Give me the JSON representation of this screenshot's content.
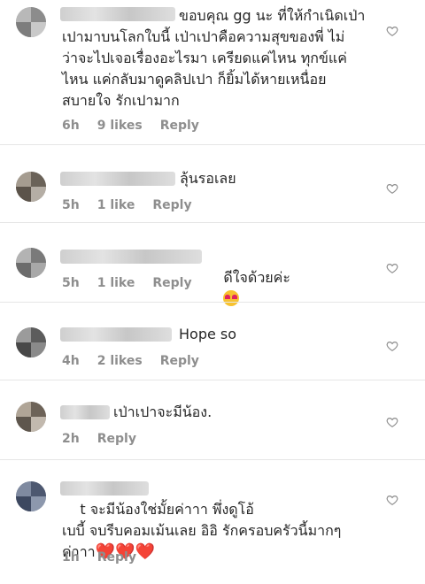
{
  "comments": [
    {
      "text": "ขอบคุณ gg นะ ที่ให้กำเนิดเป่า\nเปามาบนโลกใบนี้ เป่าเปาคือความสุขของพี่ ไม่\nว่าจะไปเจอเรื่องอะไรมา เครียดแค่ไหน ทุกข์แค่\nไหน แค่กลับมาดูคลิปเปา ก็ยิ้มได้หายเหนื่อย\nสบายใจ รักเปามาก",
      "time": "6h",
      "likes": "9 likes",
      "reply": "Reply"
    },
    {
      "text": "ลุ้นรอเลย",
      "time": "5h",
      "likes": "1 like",
      "reply": "Reply"
    },
    {
      "text": "ดีใจด้วยค่ะ",
      "emoji": "heart-eyes",
      "time": "5h",
      "likes": "1 like",
      "reply": "Reply"
    },
    {
      "text": "Hope so",
      "time": "4h",
      "likes": "2 likes",
      "reply": "Reply"
    },
    {
      "text": "เป่าเปาจะมีน้อง.",
      "time": "2h",
      "reply": "Reply"
    },
    {
      "text": "t จะมีน้องใช่มั้ยค่าาา พึ่งดูโอ้\nเบบี้ จบรีบคอมเม้นเลย อิอิ รักครอบครัวนี้มากๆ\nค่าาา",
      "emoji": "❤️❤️❤️",
      "time": "1h",
      "reply": "Reply"
    }
  ],
  "colors": {
    "text": "#262626",
    "meta": "#8e8e8e",
    "heart": "#e0245e"
  },
  "icons": {
    "like": "heart-outline-icon"
  }
}
